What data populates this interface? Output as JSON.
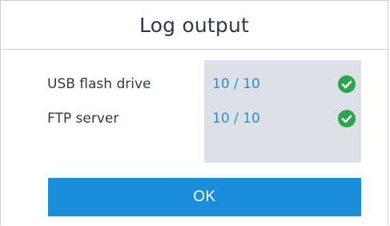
{
  "dialog": {
    "title": "Log output"
  },
  "outputs": [
    {
      "label": "USB flash drive",
      "value": "10 / 10",
      "status_icon": "check-circle-icon"
    },
    {
      "label": "FTP server",
      "value": "10 / 10",
      "status_icon": "check-circle-icon"
    }
  ],
  "ok_button": {
    "label": "OK"
  },
  "colors": {
    "accent": "#1a8edb",
    "value_text": "#2a8fd6",
    "success": "#2ea44f",
    "panel_bg": "#dde0e4"
  }
}
